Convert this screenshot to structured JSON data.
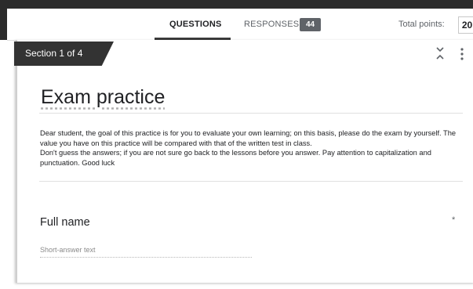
{
  "tabs": {
    "questions_label": "QUESTIONS",
    "responses_label": "RESPONSES",
    "responses_count": "44"
  },
  "points": {
    "label": "Total points:",
    "value": "20"
  },
  "section": {
    "label": "Section 1 of 4"
  },
  "form": {
    "title": "Exam practice",
    "description": [
      "Dear student, the goal of this practice is for you to evaluate your own learning; on this basis, please do the exam by yourself.  The value you have on this practice will be compared with that of the written test in class.",
      "Don't guess the answers; if you are not sure go back to the lessons before you answer. Pay attention to capitalization and punctuation. Good luck"
    ]
  },
  "question": {
    "title": "Full name",
    "required_mark": "*",
    "answer_placeholder": "Short-answer text"
  },
  "icons": {
    "collapse": "collapse-icon",
    "more": "more-vert-icon"
  },
  "colors": {
    "header_dark": "#2b2b2b",
    "section_tab": "#333333",
    "badge": "#5f6368"
  }
}
